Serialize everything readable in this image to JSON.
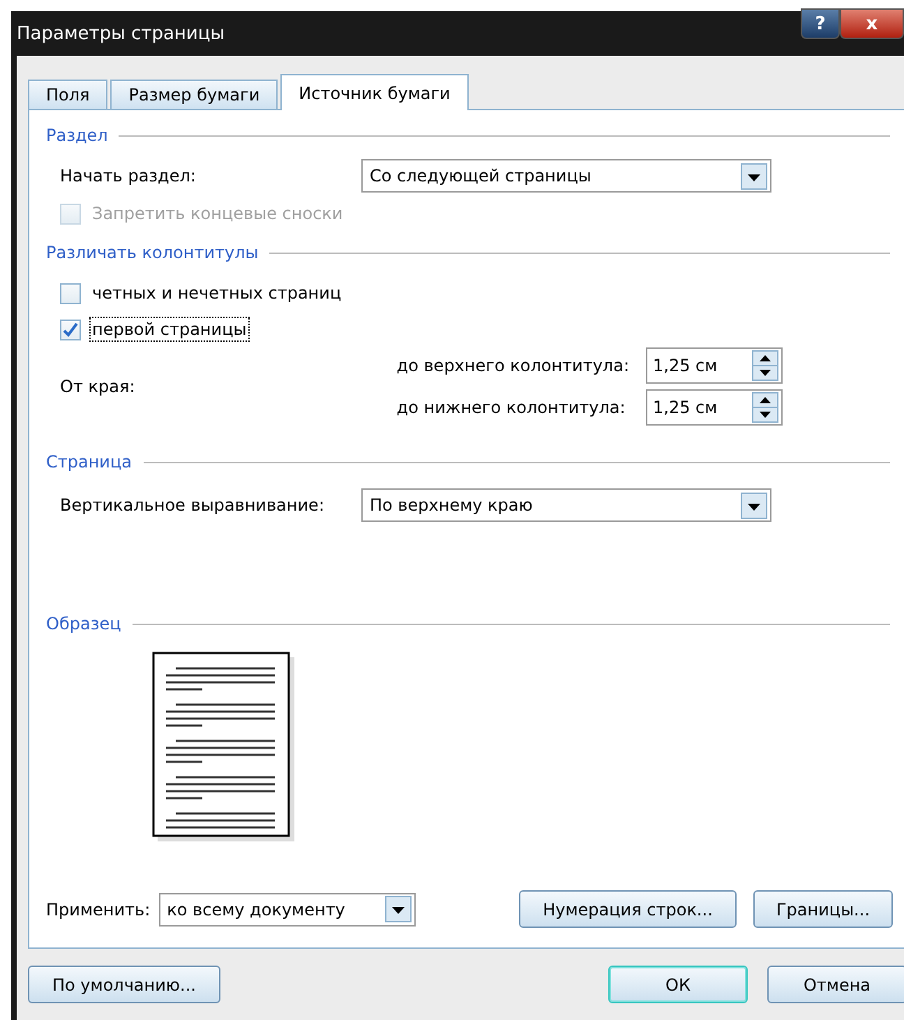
{
  "window": {
    "title": "Параметры страницы",
    "help_button": "?",
    "close_button": "x"
  },
  "tabs": [
    {
      "label": "Поля",
      "selected": false
    },
    {
      "label": "Размер бумаги",
      "selected": false
    },
    {
      "label": "Источник бумаги",
      "selected": true
    }
  ],
  "section": {
    "heading": "Раздел",
    "start_label": "Начать раздел:",
    "start_value": "Со следующей страницы",
    "suppress_endnotes": {
      "label": "Запретить концевые сноски",
      "checked": false,
      "disabled": true
    }
  },
  "headers_footers": {
    "heading": "Различать колонтитулы",
    "options": [
      {
        "label": "четных и нечетных страниц",
        "checked": false,
        "focused": false
      },
      {
        "label": "первой страницы",
        "checked": true,
        "focused": true
      }
    ],
    "from_edge_label": "От края:",
    "distances": [
      {
        "label": "до верхнего колонтитула:",
        "value": "1,25 см"
      },
      {
        "label": "до нижнего колонтитула:",
        "value": "1,25 см"
      }
    ]
  },
  "page": {
    "heading": "Страница",
    "vertical_label": "Вертикальное выравнивание:",
    "vertical_value": "По верхнему краю"
  },
  "preview": {
    "heading": "Образец"
  },
  "apply": {
    "label": "Применить:",
    "value": "ко всему документу"
  },
  "panel_buttons": [
    "Нумерация строк...",
    "Границы..."
  ],
  "footer": {
    "default_button": "По умолчанию...",
    "ok_button": "ОК",
    "cancel_button": "Отмена"
  }
}
